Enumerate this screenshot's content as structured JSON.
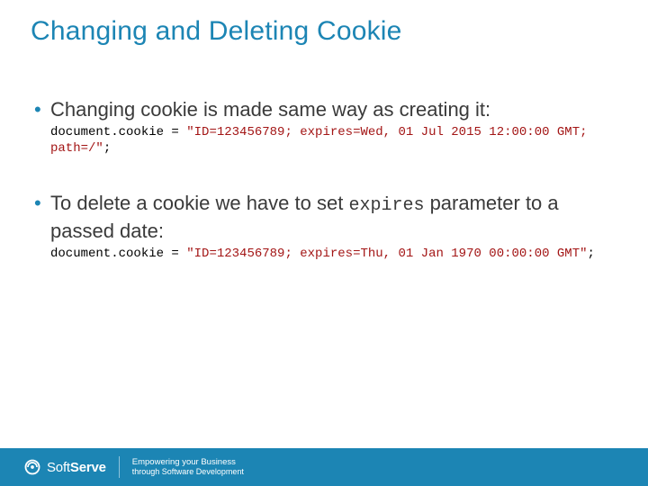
{
  "title": "Changing and Deleting Cookie",
  "bullets": [
    {
      "text": "Changing cookie is made same way as creating it:",
      "code_black": "document.cookie = ",
      "code_brown": "\"ID=123456789; expires=Wed, 01 Jul 2015 12:00:00 GMT; path=/\"",
      "code_tail": ";"
    },
    {
      "text_pre": "To delete a cookie we have to set ",
      "text_mono": "expires",
      "text_post": " parameter to a passed date:",
      "code_black": "document.cookie = ",
      "code_brown": "\"ID=123456789; expires=Thu, 01 Jan 1970 00:00:00 GMT\"",
      "code_tail": ";"
    }
  ],
  "footer": {
    "brand_prefix": "Soft",
    "brand_suffix": "Serve",
    "tagline_top": "Empowering your Business",
    "tagline_bottom": "through Software Development"
  }
}
